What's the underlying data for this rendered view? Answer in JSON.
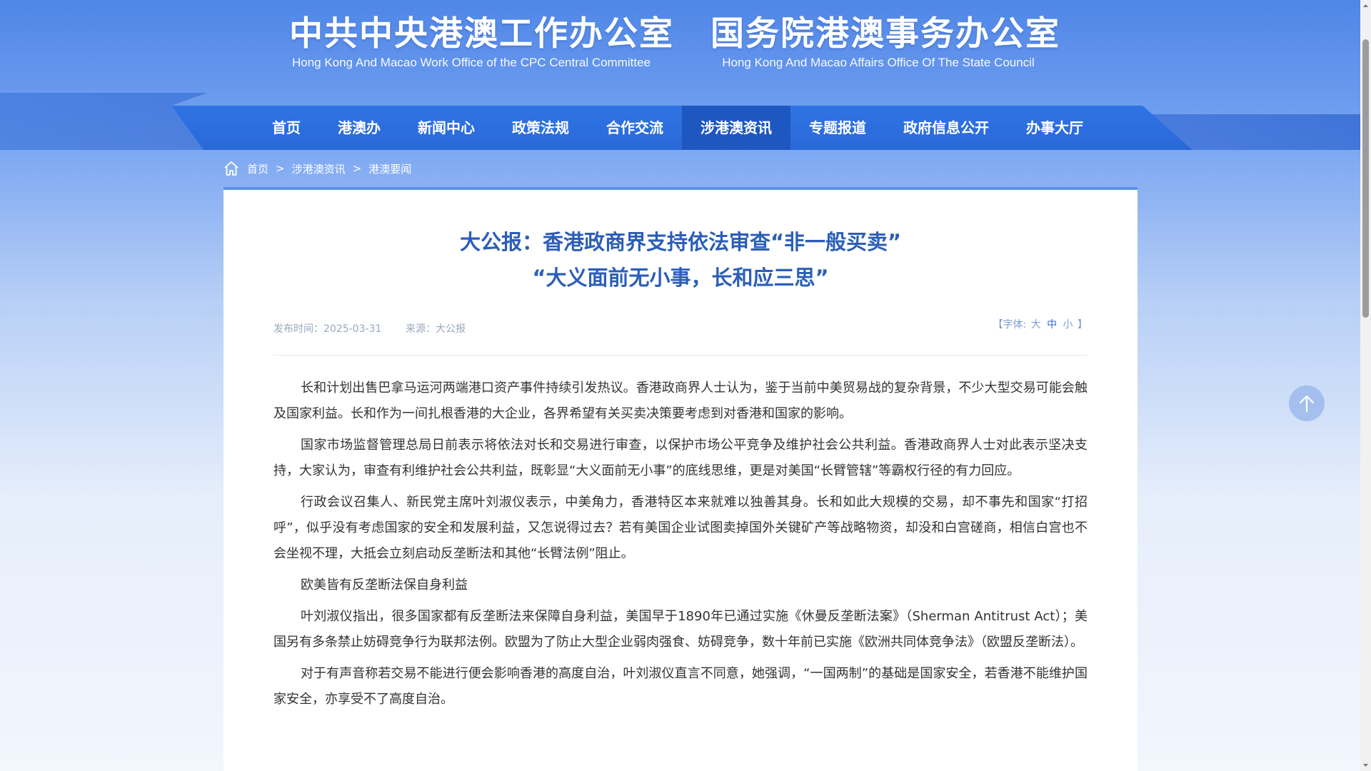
{
  "header": {
    "left_title": "中共中央港澳工作办公室",
    "left_subtitle": "Hong Kong And Macao Work Office of the CPC Central Committee",
    "right_title": "国务院港澳事务办公室",
    "right_subtitle": "Hong Kong And Macao Affairs Office Of The State Council"
  },
  "nav": {
    "items": [
      {
        "label": "首页"
      },
      {
        "label": "港澳办"
      },
      {
        "label": "新闻中心"
      },
      {
        "label": "政策法规"
      },
      {
        "label": "合作交流"
      },
      {
        "label": "涉港澳资讯",
        "active": true
      },
      {
        "label": "专题报道"
      },
      {
        "label": "政府信息公开"
      },
      {
        "label": "办事大厅"
      }
    ]
  },
  "breadcrumb": {
    "items": [
      "首页",
      "涉港澳资讯",
      "港澳要闻"
    ],
    "separator": ">"
  },
  "article": {
    "title_line1": "大公报：香港政商界支持依法审查“非一般买卖”",
    "title_line2": "“大义面前无小事，长和应三思”",
    "publish_time": "发布时间：2025-03-31",
    "source": "来源：大公报",
    "font_size": {
      "open": "【字体:",
      "large": "大",
      "medium": "中",
      "small": "小",
      "close": "】",
      "selected": "medium"
    },
    "paragraphs": [
      "长和计划出售巴拿马运河两端港口资产事件持续引发热议。香港政商界人士认为，鉴于当前中美贸易战的复杂背景，不少大型交易可能会触及国家利益。长和作为一间扎根香港的大企业，各界希望有关买卖决策要考虑到对香港和国家的影响。",
      "国家市场监督管理总局日前表示将依法对长和交易进行审查，以保护市场公平竞争及维护社会公共利益。香港政商界人士对此表示坚决支持，大家认为，审查有利维护社会公共利益，既彰显“大义面前无小事”的底线思维，更是对美国“长臂管辖”等霸权行径的有力回应。",
      "行政会议召集人、新民党主席叶刘淑仪表示，中美角力，香港特区本来就难以独善其身。长和如此大规模的交易，却不事先和国家“打招呼”，似乎没有考虑国家的安全和发展利益，又怎说得过去？若有美国企业试图卖掉国外关键矿产等战略物资，却没和白宫磋商，相信白宫也不会坐视不理，大抵会立刻启动反垄断法和其他“长臂法例”阻止。",
      "欧美皆有反垄断法保自身利益",
      "叶刘淑仪指出，很多国家都有反垄断法来保障自身利益，美国早于1890年已通过实施《休曼反垄断法案》（Sherman Antitrust Act）；美国另有多条禁止妨碍竞争行为联邦法例。欧盟为了防止大型企业弱肉强食、妨碍竞争，数十年前已实施《欧洲共同体竞争法》（欧盟反垄断法）。",
      "对于有声音称若交易不能进行便会影响香港的高度自治，叶刘淑仪直言不同意，她强调，“一国两制”的基础是国家安全，若香港不能维护国家安全，亦享受不了高度自治。"
    ]
  },
  "colors": {
    "nav_bg": "#2a6ddc",
    "nav_active": "#1f57c0",
    "title": "#2b5eb8",
    "meta": "#9aa7bd",
    "body_text": "#333333"
  },
  "icons": {
    "breadcrumb_home": "home-icon",
    "back_to_top": "arrow-up-icon"
  }
}
